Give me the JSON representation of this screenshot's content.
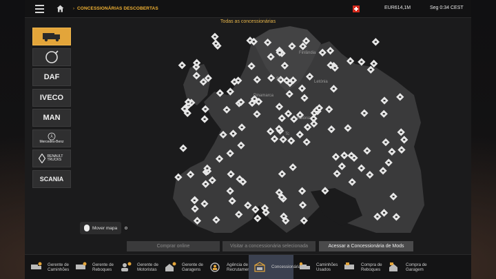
{
  "header": {
    "breadcrumb": "CONCESSIONÁRIAS DESCOBERTAS",
    "money": "EUR614,1M",
    "clock": "Seg 0:34 CEST"
  },
  "map": {
    "title": "Todas as concessionárias",
    "labels": [
      "Finlândia",
      "Su",
      "Letónia",
      "Dinamarca",
      "Polónia",
      "Tc"
    ]
  },
  "brands": [
    {
      "name": "truck-icon",
      "label": ""
    },
    {
      "name": "volvo",
      "label": "VOLVO"
    },
    {
      "name": "daf",
      "label": "DAF"
    },
    {
      "name": "iveco",
      "label": "IVECO"
    },
    {
      "name": "man",
      "label": "MAN"
    },
    {
      "name": "mercedes-benz",
      "label": "Mercedes-Benz"
    },
    {
      "name": "renault-trucks",
      "label": "RENAULT TRUCKS"
    },
    {
      "name": "scania",
      "label": "SCANIA"
    }
  ],
  "move_map": "Mover mapa",
  "actions": {
    "buy": "Comprar online",
    "visit": "Visitar a concessionária selecionada",
    "mods": "Acessar a Concessionária de Mods"
  },
  "tabs": [
    {
      "label": "Gerente de Caminhões",
      "icon": "truck-gear-icon"
    },
    {
      "label": "Gerente de Reboques",
      "icon": "trailer-gear-icon"
    },
    {
      "label": "Gerente de Motoristas",
      "icon": "drivers-gear-icon"
    },
    {
      "label": "Gerente de Garagens",
      "icon": "garage-gear-icon"
    },
    {
      "label": "Agência de Recrutamento",
      "icon": "recruitment-icon"
    },
    {
      "label": "Concessionárias",
      "icon": "dealer-icon"
    },
    {
      "label": "Caminhões Usados",
      "icon": "used-trucks-icon"
    },
    {
      "label": "Compra de Reboques",
      "icon": "buy-trailer-icon"
    },
    {
      "label": "Compra de Garagem",
      "icon": "buy-garage-icon"
    }
  ],
  "colors": {
    "accent": "#f2b233",
    "active_tab": "#3b4150",
    "marker": "#e8e8e8"
  }
}
